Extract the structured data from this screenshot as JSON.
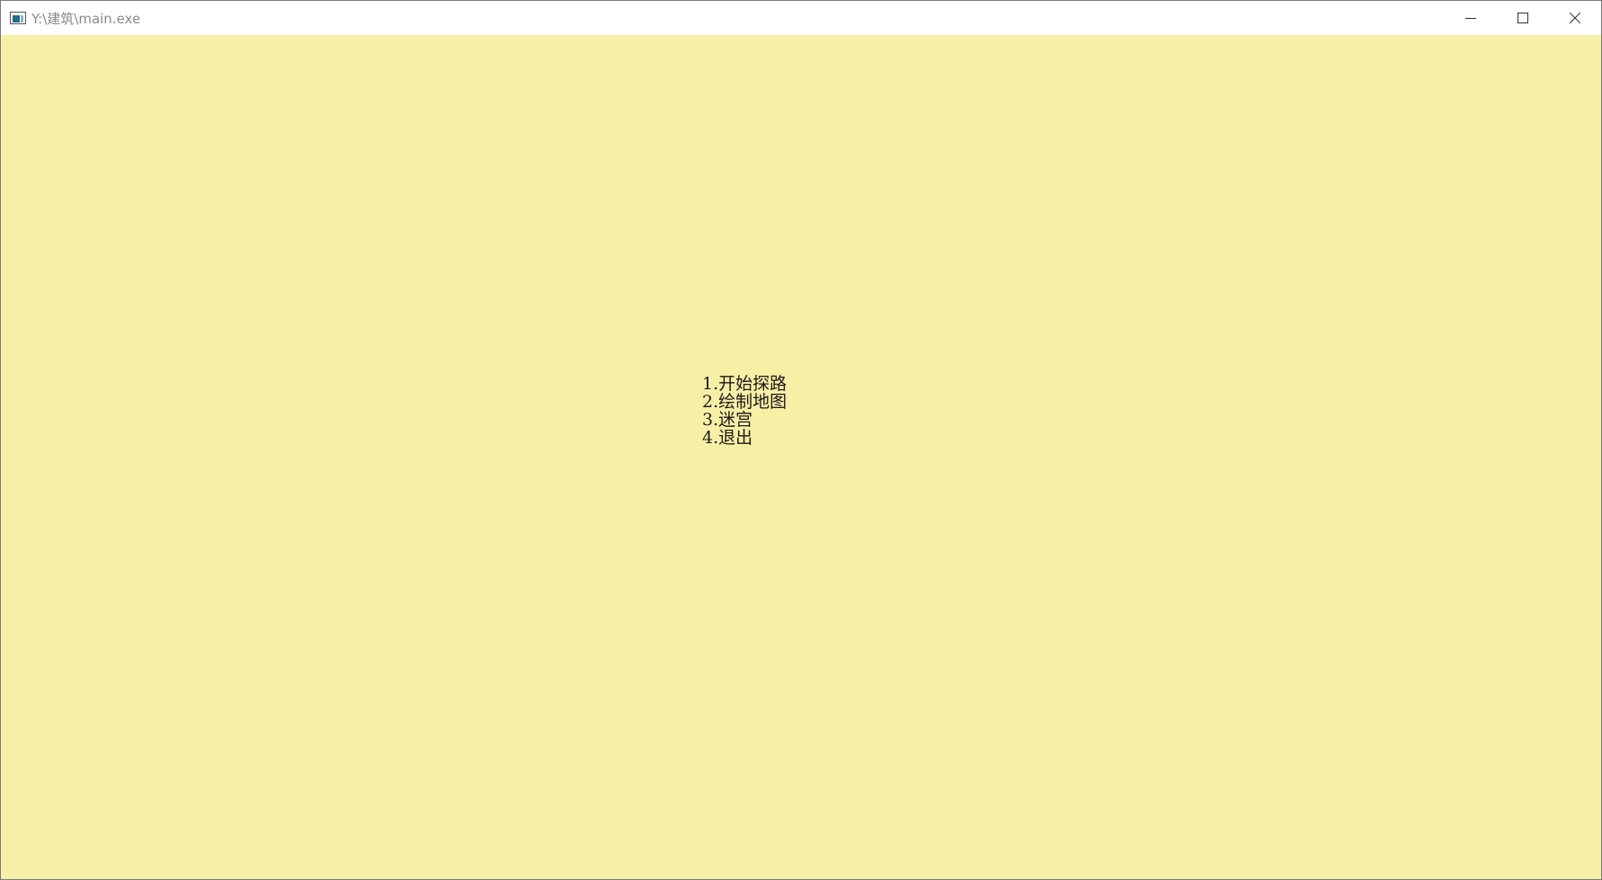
{
  "window": {
    "title": "Y:\\建筑\\main.exe",
    "icon": "console-app-icon",
    "background_color": "#f8efa7"
  },
  "controls": {
    "minimize_icon": "minimize-icon",
    "maximize_icon": "maximize-icon",
    "close_icon": "close-icon"
  },
  "menu": {
    "items": [
      {
        "label": "1.开始探路"
      },
      {
        "label": "2.绘制地图"
      },
      {
        "label": "3.迷宫"
      },
      {
        "label": "4.退出"
      }
    ]
  }
}
